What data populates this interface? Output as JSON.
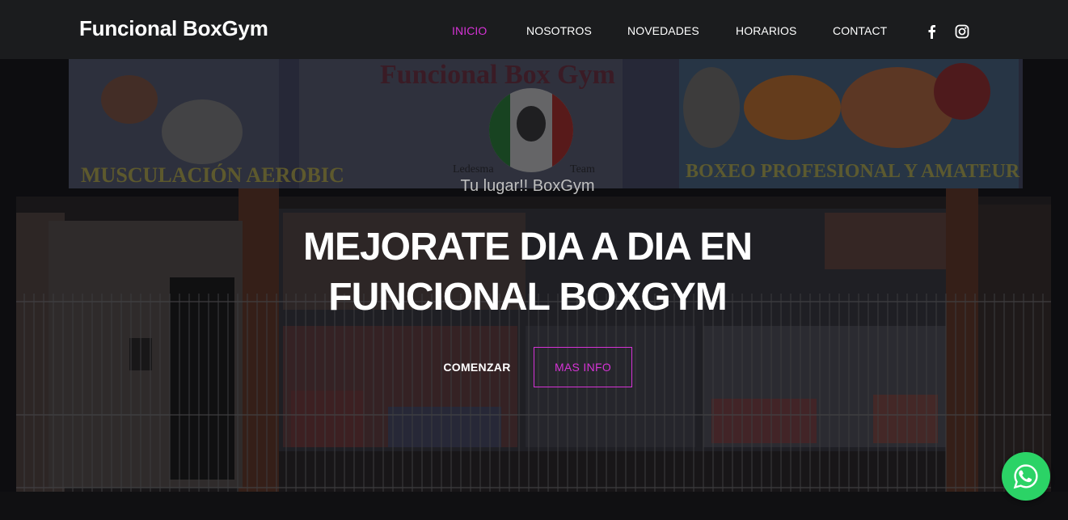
{
  "brand": {
    "name": "Funcional BoxGym"
  },
  "nav": {
    "items": [
      {
        "label": "INICIO",
        "active": true
      },
      {
        "label": "NOSOTROS",
        "active": false
      },
      {
        "label": "NOVEDADES",
        "active": false
      },
      {
        "label": "HORARIOS",
        "active": false
      },
      {
        "label": "CONTACT",
        "active": false
      }
    ],
    "social": [
      {
        "icon": "facebook-icon"
      },
      {
        "icon": "instagram-icon"
      }
    ]
  },
  "hero": {
    "eyebrow": "Tu lugar!! BoxGym",
    "headline_line1": "MEJORATE DIA A DIA EN",
    "headline_line2": "FUNCIONAL BOXGYM",
    "btn_start": "COMENZAR",
    "btn_more": "MAS INFO",
    "sign": {
      "title": "Funcional Box Gym",
      "left": "MUSCULACIÓN AEROBIC",
      "right": "BOXEO PROFESIONAL Y AMATEUR",
      "logo_left": "Ledesma",
      "logo_right": "Team"
    }
  },
  "floating": {
    "icon": "whatsapp-icon"
  },
  "colors": {
    "accent": "#d633d6",
    "navbar": "#1b1c1e",
    "whatsapp": "#2bd366"
  }
}
